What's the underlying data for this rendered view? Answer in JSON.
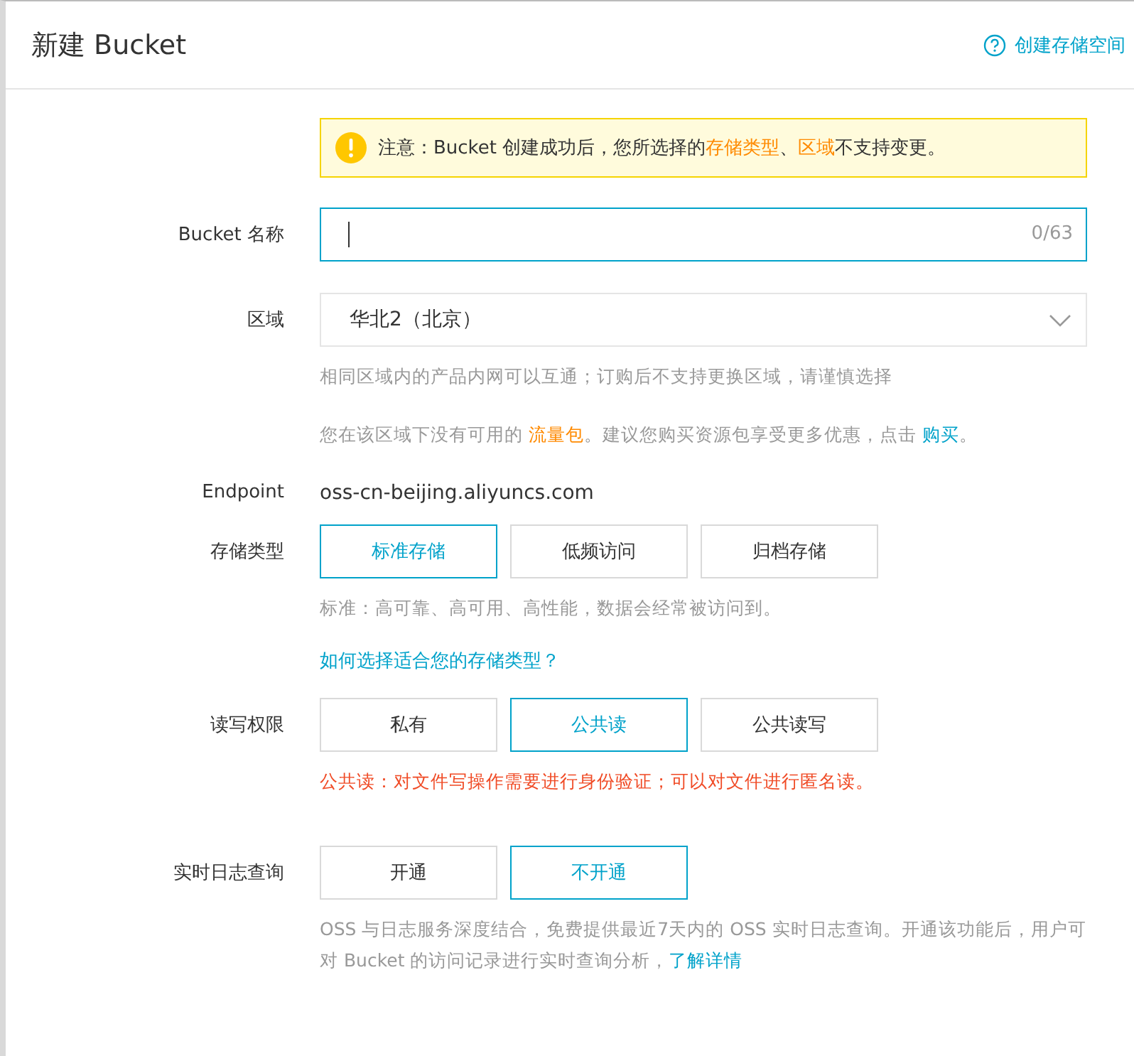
{
  "header": {
    "title": "新建 Bucket",
    "help_link": "创建存储空间"
  },
  "notice": [
    {
      "kind": "text",
      "text": "注意：Bucket 创建成功后，您所选择的"
    },
    {
      "kind": "highlight",
      "text": "存储类型"
    },
    {
      "kind": "text",
      "text": "、"
    },
    {
      "kind": "highlight",
      "text": "区域"
    },
    {
      "kind": "text",
      "text": "不支持变更。"
    }
  ],
  "bucket_name": {
    "label": "Bucket 名称",
    "counter": "0/63"
  },
  "region": {
    "label": "区域",
    "value": "华北2（北京）",
    "hint": "相同区域内的产品内网可以互通；订购后不支持更换区域，请谨慎选择",
    "tip": [
      {
        "kind": "text",
        "text": "您在该区域下没有可用的 "
      },
      {
        "kind": "highlight",
        "text": "流量包"
      },
      {
        "kind": "text",
        "text": "。建议您购买资源包享受更多优惠，点击 "
      },
      {
        "kind": "link",
        "text": "购买"
      },
      {
        "kind": "text",
        "text": "。"
      }
    ]
  },
  "endpoint": {
    "label": "Endpoint",
    "value": "oss-cn-beijing.aliyuncs.com"
  },
  "storage_class": {
    "label": "存储类型",
    "options": [
      {
        "label": "标准存储",
        "selected": true
      },
      {
        "label": "低频访问",
        "selected": false
      },
      {
        "label": "归档存储",
        "selected": false
      }
    ],
    "description": "标准：高可靠、高可用、高性能，数据会经常被访问到。",
    "help_link": "如何选择适合您的存储类型？"
  },
  "acl": {
    "label": "读写权限",
    "options": [
      {
        "label": "私有",
        "selected": false
      },
      {
        "label": "公共读",
        "selected": true
      },
      {
        "label": "公共读写",
        "selected": false
      }
    ],
    "warning": "公共读：对文件写操作需要进行身份验证；可以对文件进行匿名读。"
  },
  "realtime_log": {
    "label": "实时日志查询",
    "options": [
      {
        "label": "开通",
        "selected": false
      },
      {
        "label": "不开通",
        "selected": true
      }
    ],
    "description": [
      {
        "kind": "text",
        "text": "OSS 与日志服务深度结合，免费提供最近7天内的 OSS 实时日志查询。开通该功能后，用户可对 Bucket 的访问记录进行实时查询分析，"
      },
      {
        "kind": "link",
        "text": "了解详情"
      }
    ]
  }
}
